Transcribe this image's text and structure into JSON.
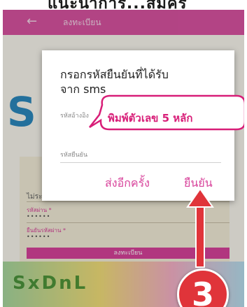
{
  "caption": {
    "text": "แนะนำการ...สมัคร"
  },
  "appbar": {
    "back_icon": "←",
    "title": "ลงทะเบียน"
  },
  "background": {
    "logo_letter": "S",
    "text_line": "ไม่ระบุตัวตน",
    "password_label": "รหัสผ่าน *",
    "password_value": "••••••",
    "confirm_password_label": "ยืนยันรหัสผ่าน *",
    "confirm_password_value": "••••••",
    "register_button": "ลงทะเบียน",
    "banner_text": "SxDnL"
  },
  "dialog": {
    "title": "กรอกรหัสยืนยันที่ได้รับ\nจาก sms",
    "ref_code_label": "รหัสอ้างอิง",
    "verify_code_label": "รหัสยืนยัน",
    "resend_button": "ส่งอีกครั้ง",
    "confirm_button": "ยืนยัน"
  },
  "annotation": {
    "callout_text": "พิมพ์ตัวเลข 5 หลัก",
    "step_number": "3",
    "accent_color": "#d81e78",
    "arrow_color": "#e0343a"
  }
}
